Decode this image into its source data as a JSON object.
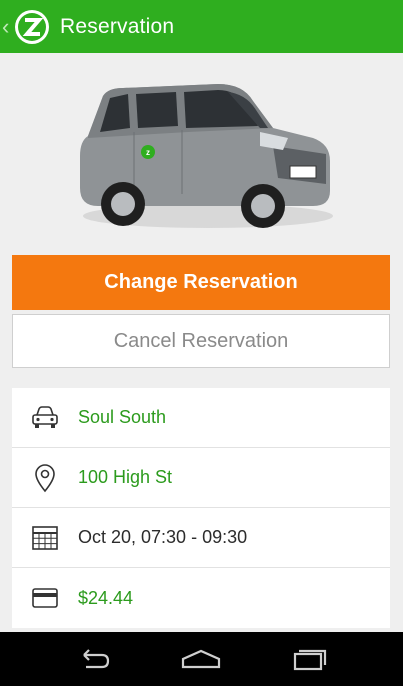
{
  "appbar": {
    "title": "Reservation",
    "back_icon": "chevron-left-icon",
    "logo_icon": "zipcar-logo-icon"
  },
  "car": {
    "image": "car-image"
  },
  "buttons": {
    "change_label": "Change Reservation",
    "cancel_label": "Cancel Reservation"
  },
  "details": [
    {
      "icon": "car-icon",
      "text": "Soul South"
    },
    {
      "icon": "location-pin-icon",
      "text": "100 High St"
    },
    {
      "icon": "calendar-icon",
      "text": "Oct 20, 07:30 - 09:30"
    },
    {
      "icon": "credit-card-icon",
      "text": "$24.44"
    }
  ],
  "navbar": {
    "back_icon": "nav-back-icon",
    "home_icon": "nav-home-icon",
    "recents_icon": "nav-recents-icon"
  },
  "colors": {
    "brand_green": "#2fae1f",
    "accent_orange": "#f4780f",
    "link_green": "#2c9b1d"
  }
}
